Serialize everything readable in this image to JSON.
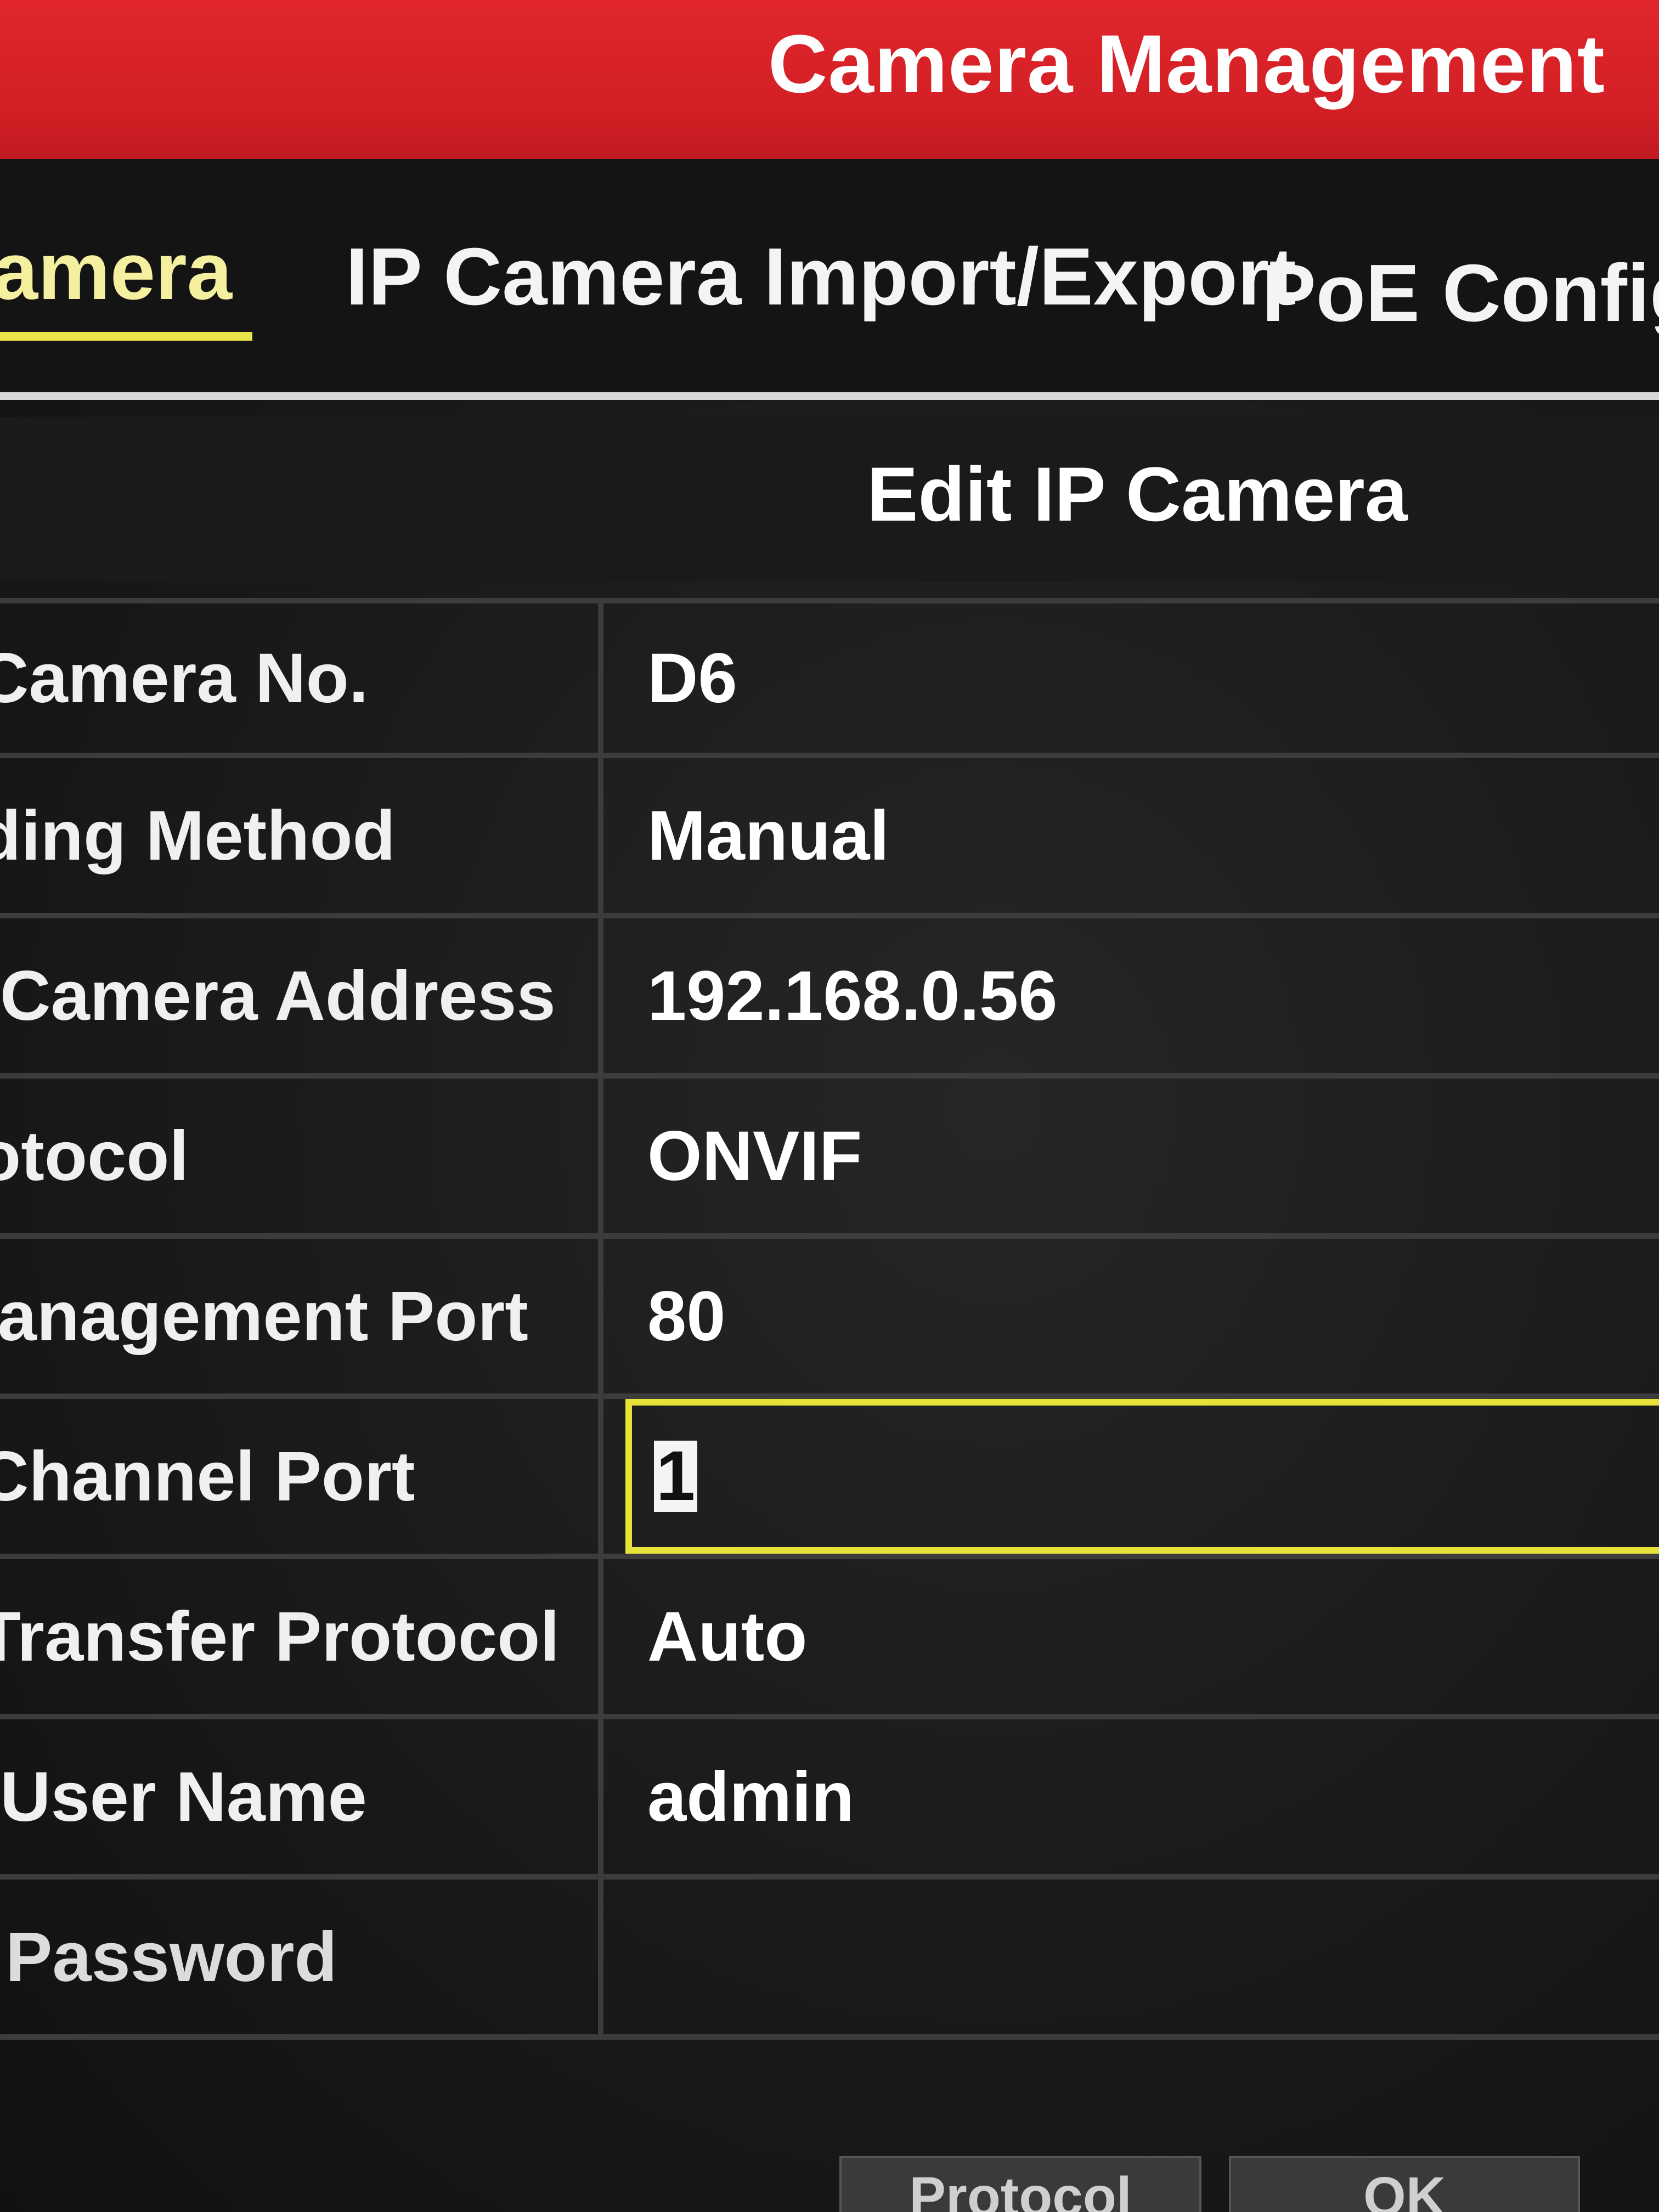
{
  "window": {
    "title": "Camera Management"
  },
  "tabs": [
    {
      "label": "Camera",
      "active": true
    },
    {
      "label": "IP Camera Import/Export",
      "active": false
    },
    {
      "label": "PoE Configu",
      "active": false
    }
  ],
  "dialog": {
    "title": "Edit IP Camera",
    "fields": [
      {
        "label": "Camera No.",
        "value": "D6"
      },
      {
        "label": "ding Method",
        "value": "Manual"
      },
      {
        "label": "Camera Address",
        "value": "192.168.0.56"
      },
      {
        "label": "otocol",
        "value": "ONVIF"
      },
      {
        "label": "lanagement Port",
        "value": "80"
      },
      {
        "label": "Channel Port",
        "value": "1"
      },
      {
        "label": "Transfer Protocol",
        "value": "Auto"
      },
      {
        "label": "User Name",
        "value": "admin"
      },
      {
        "label": "Password",
        "value": ""
      }
    ]
  },
  "buttons": {
    "protocol": "Protocol",
    "ok": "OK"
  },
  "colors": {
    "title_bar": "#d21f25",
    "focus_border": "#e6e23a",
    "active_tab_underline": "#e9e24a"
  }
}
